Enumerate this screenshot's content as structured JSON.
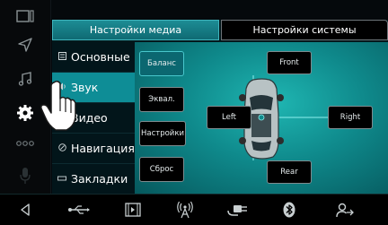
{
  "tabs": {
    "media": "Настройки медиа",
    "system": "Настройки системы"
  },
  "menu": [
    {
      "label": "Основные",
      "icon": "list-icon",
      "active": false
    },
    {
      "label": "Звук",
      "icon": "speaker-icon",
      "active": true
    },
    {
      "label": "Видео",
      "icon": "video-icon",
      "active": false
    },
    {
      "label": "Навигация",
      "icon": "compass-icon",
      "active": false
    },
    {
      "label": "Закладки",
      "icon": "bookmark-icon",
      "active": false
    }
  ],
  "sound": {
    "balance_button": "Баланс",
    "eq_button": "Эквал.",
    "settings_button": "Настройки",
    "reset_button": "Сброс",
    "front": "Front",
    "rear": "Rear",
    "left": "Left",
    "right": "Right"
  },
  "colors": {
    "accent": "#0e8d96",
    "panel": "#1fb6b2",
    "background": "#05090c"
  },
  "icons": {
    "rail": [
      "window-icon",
      "navigation-arrow-icon",
      "music-note-icon",
      "gear-icon",
      "more-icon",
      "microphone-icon",
      "back-icon"
    ],
    "bottom": [
      "usb-icon",
      "video-player-icon",
      "antenna-icon",
      "aux-plug-icon",
      "bluetooth-icon",
      "phone-link-icon"
    ]
  }
}
